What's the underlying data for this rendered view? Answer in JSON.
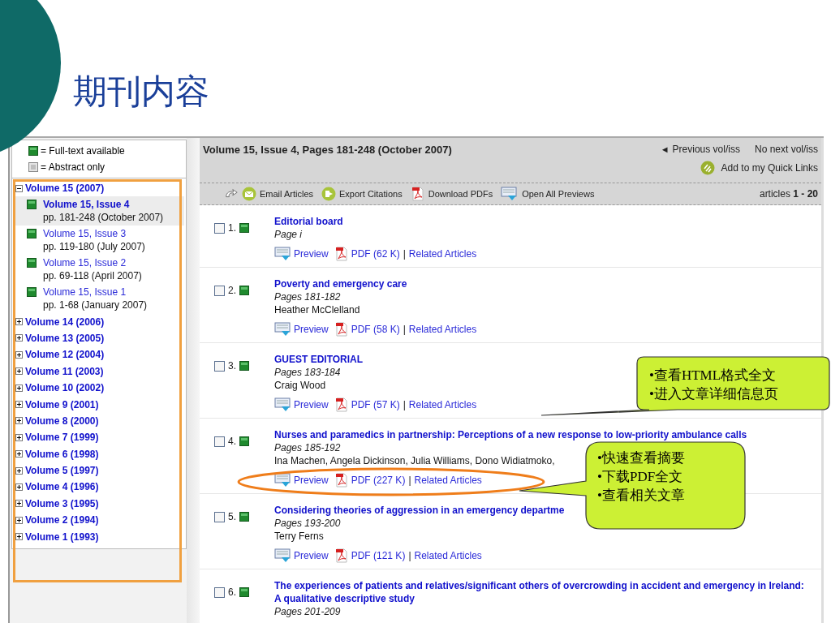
{
  "slide": {
    "title": "期刊内容"
  },
  "legend": [
    {
      "kind": "full",
      "label": "= Full-text available"
    },
    {
      "kind": "abstract",
      "label": "= Abstract only"
    }
  ],
  "volumes": [
    {
      "label": "Volume 15 (2007)",
      "expanded": true,
      "children": [
        {
          "label": "Volume 15, Issue 4",
          "pages": "pp. 181-248 (October 2007)",
          "selected": true
        },
        {
          "label": "Volume 15, Issue 3",
          "pages": "pp. 119-180 (July 2007)",
          "selected": false
        },
        {
          "label": "Volume 15, Issue 2",
          "pages": "pp. 69-118 (April 2007)",
          "selected": false
        },
        {
          "label": "Volume 15, Issue 1",
          "pages": "pp. 1-68 (January 2007)",
          "selected": false
        }
      ]
    },
    {
      "label": "Volume 14 (2006)",
      "expanded": false
    },
    {
      "label": "Volume 13 (2005)",
      "expanded": false
    },
    {
      "label": "Volume 12 (2004)",
      "expanded": false
    },
    {
      "label": "Volume 11 (2003)",
      "expanded": false
    },
    {
      "label": "Volume 10 (2002)",
      "expanded": false
    },
    {
      "label": "Volume 9 (2001)",
      "expanded": false
    },
    {
      "label": "Volume 8 (2000)",
      "expanded": false
    },
    {
      "label": "Volume 7 (1999)",
      "expanded": false
    },
    {
      "label": "Volume 6 (1998)",
      "expanded": false
    },
    {
      "label": "Volume 5 (1997)",
      "expanded": false
    },
    {
      "label": "Volume 4 (1996)",
      "expanded": false
    },
    {
      "label": "Volume 3 (1995)",
      "expanded": false
    },
    {
      "label": "Volume 2 (1994)",
      "expanded": false
    },
    {
      "label": "Volume 1 (1993)",
      "expanded": false
    }
  ],
  "header": {
    "title": "Volume 15, Issue 4, Pages 181-248 (October 2007)",
    "prev_arrow": "◄",
    "prev": "Previous vol/iss",
    "next": "No next vol/iss",
    "quick_links": "Add to my Quick Links"
  },
  "toolbar": {
    "actions": [
      {
        "kind": "email",
        "label": "Email Articles"
      },
      {
        "kind": "export",
        "label": "Export Citations"
      },
      {
        "kind": "pdf",
        "label": "Download PDFs"
      },
      {
        "kind": "preview",
        "label": "Open All Previews"
      }
    ],
    "count_label": "articles",
    "count_range": "1 - 20"
  },
  "link_separator": "|",
  "articles": [
    {
      "number": "1.",
      "checked": false,
      "full_text": true,
      "title": "Editorial board",
      "pages": "Page i",
      "preview": "Preview",
      "pdf": "PDF (62 K)",
      "related": "Related Articles"
    },
    {
      "number": "2.",
      "checked": false,
      "full_text": true,
      "title": "Poverty and emergency care",
      "pages": "Pages 181-182",
      "authors": "Heather McClelland",
      "preview": "Preview",
      "pdf": "PDF (58 K)",
      "related": "Related Articles"
    },
    {
      "number": "3.",
      "checked": false,
      "full_text": true,
      "title": "GUEST EDITORIAL",
      "pages": "Pages 183-184",
      "authors": "Craig Wood",
      "preview": "Preview",
      "pdf": "PDF (57 K)",
      "related": "Related Articles"
    },
    {
      "number": "4.",
      "checked": false,
      "full_text": true,
      "title": "Nurses and paramedics in partnership: Perceptions of a new response to low-priority ambulance calls",
      "pages": "Pages 185-192",
      "authors": "Ina Machen, Angela Dickinson, Julia Williams, Dono Widiatmoko,",
      "preview": "Preview",
      "pdf": "PDF (227 K)",
      "related": "Related Articles"
    },
    {
      "number": "5.",
      "checked": false,
      "full_text": true,
      "title": "Considering theories of aggression in an emergency departme",
      "pages": "Pages 193-200",
      "authors": "Terry Ferns",
      "preview": "Preview",
      "pdf": "PDF (121 K)",
      "related": "Related Articles"
    },
    {
      "number": "6.",
      "checked": false,
      "full_text": true,
      "title": "The experiences of patients and relatives/significant others of overcrowding in accident and emergency in Ireland: A qualitative descriptive study",
      "pages": "Pages 201-209"
    }
  ],
  "callouts": [
    {
      "lines": [
        "•查看HTML格式全文",
        "•进入文章详细信息页"
      ]
    },
    {
      "lines": [
        "•快速查看摘要",
        "•下载PDF全文",
        "•查看相关文章"
      ]
    }
  ]
}
